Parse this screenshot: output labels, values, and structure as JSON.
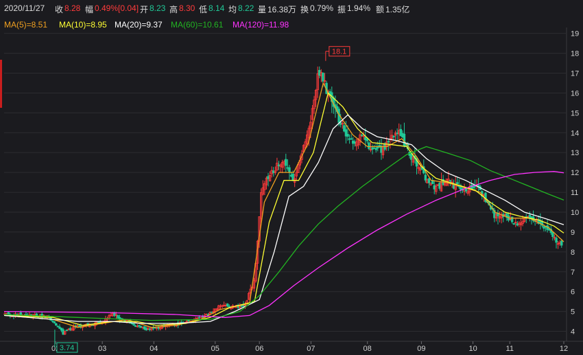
{
  "quote_bar": {
    "date": "2020/11/27",
    "close_label": "收",
    "close_value": "8.28",
    "change_label": "幅",
    "change_value": "0.49%[0.04]",
    "open_label": "开",
    "open_value": "8.23",
    "high_label": "高",
    "high_value": "8.30",
    "low_label": "低",
    "low_value": "8.14",
    "avg_label": "均",
    "avg_value": "8.22",
    "volume_label": "量",
    "volume_value": "16.38万",
    "turnover_label": "换",
    "turnover_value": "0.79%",
    "amplitude_label": "振",
    "amplitude_value": "1.94%",
    "amount_label": "额",
    "amount_value": "1.35亿"
  },
  "ma_legend": [
    {
      "text": "MA(5)=8.51",
      "color": "#f0a020"
    },
    {
      "text": "MA(10)=8.95",
      "color": "#ffff33"
    },
    {
      "text": "MA(20)=9.37",
      "color": "#ffffff"
    },
    {
      "text": "MA(60)=10.61",
      "color": "#22b422"
    },
    {
      "text": "MA(120)=11.98",
      "color": "#ff33ff"
    }
  ],
  "colors": {
    "up": "#ff3b3b",
    "down": "#20c997",
    "grid": "#2c2c30",
    "background": "#1b1b1f"
  },
  "chart_data": {
    "type": "candlestick",
    "ylim": [
      3.5,
      19.3
    ],
    "yticks": [
      4,
      5,
      6,
      7,
      8,
      9,
      10,
      11,
      12,
      13,
      14,
      15,
      16,
      17,
      18,
      19
    ],
    "xticks": [
      "02",
      "03",
      "04",
      "05",
      "06",
      "07",
      "08",
      "09",
      "10",
      "11",
      "12"
    ],
    "xlim": [
      0,
      228
    ],
    "xtick_positions": [
      21,
      40,
      61,
      86,
      104,
      125,
      148,
      170,
      191,
      206,
      228
    ],
    "annotations": [
      {
        "label": "18.1",
        "x": 131,
        "y": 18.1,
        "type": "high"
      },
      {
        "label": "3.74",
        "x": 24,
        "y": 3.74,
        "type": "low"
      }
    ],
    "price_path": [
      [
        0,
        4.85
      ],
      [
        10,
        4.8
      ],
      [
        18,
        4.75
      ],
      [
        22,
        4.2
      ],
      [
        24,
        3.9
      ],
      [
        28,
        4.2
      ],
      [
        34,
        4.3
      ],
      [
        40,
        4.5
      ],
      [
        44,
        4.9
      ],
      [
        48,
        4.6
      ],
      [
        54,
        4.3
      ],
      [
        58,
        4.1
      ],
      [
        64,
        4.2
      ],
      [
        72,
        4.4
      ],
      [
        78,
        4.6
      ],
      [
        84,
        4.9
      ],
      [
        88,
        5.3
      ],
      [
        92,
        5.2
      ],
      [
        98,
        5.3
      ],
      [
        102,
        6.6
      ],
      [
        105,
        11.3
      ],
      [
        110,
        12.2
      ],
      [
        114,
        12.5
      ],
      [
        118,
        11.5
      ],
      [
        121,
        12.8
      ],
      [
        125,
        14.5
      ],
      [
        128,
        17.2
      ],
      [
        131,
        16.3
      ],
      [
        134,
        15.3
      ],
      [
        137,
        14.5
      ],
      [
        140,
        13.8
      ],
      [
        143,
        13.6
      ],
      [
        146,
        13.8
      ],
      [
        150,
        13.0
      ],
      [
        154,
        13.2
      ],
      [
        158,
        13.7
      ],
      [
        161,
        14.0
      ],
      [
        164,
        13.1
      ],
      [
        168,
        12.5
      ],
      [
        172,
        11.6
      ],
      [
        176,
        11.2
      ],
      [
        180,
        11.6
      ],
      [
        184,
        11.3
      ],
      [
        188,
        11.1
      ],
      [
        192,
        11.4
      ],
      [
        196,
        10.7
      ],
      [
        200,
        9.8
      ],
      [
        204,
        9.9
      ],
      [
        208,
        9.4
      ],
      [
        212,
        9.7
      ],
      [
        216,
        9.7
      ],
      [
        220,
        9.3
      ],
      [
        224,
        8.7
      ],
      [
        228,
        8.28
      ]
    ],
    "ma_series": [
      {
        "name": "MA(5)",
        "color": "#f0a020",
        "points": [
          [
            0,
            4.8
          ],
          [
            20,
            4.6
          ],
          [
            30,
            4.2
          ],
          [
            40,
            4.4
          ],
          [
            50,
            4.6
          ],
          [
            60,
            4.2
          ],
          [
            70,
            4.3
          ],
          [
            80,
            4.6
          ],
          [
            88,
            5.1
          ],
          [
            100,
            5.4
          ],
          [
            106,
            10.5
          ],
          [
            112,
            12.0
          ],
          [
            118,
            12.0
          ],
          [
            124,
            13.5
          ],
          [
            130,
            16.5
          ],
          [
            136,
            15.0
          ],
          [
            142,
            13.9
          ],
          [
            148,
            13.3
          ],
          [
            156,
            13.3
          ],
          [
            162,
            13.7
          ],
          [
            168,
            12.8
          ],
          [
            174,
            11.6
          ],
          [
            180,
            11.5
          ],
          [
            186,
            11.3
          ],
          [
            194,
            11.0
          ],
          [
            200,
            10.0
          ],
          [
            206,
            9.7
          ],
          [
            214,
            9.7
          ],
          [
            222,
            9.2
          ],
          [
            228,
            8.51
          ]
        ]
      },
      {
        "name": "MA(10)",
        "color": "#ffff33",
        "points": [
          [
            0,
            4.8
          ],
          [
            20,
            4.7
          ],
          [
            32,
            4.3
          ],
          [
            44,
            4.5
          ],
          [
            54,
            4.5
          ],
          [
            62,
            4.3
          ],
          [
            74,
            4.4
          ],
          [
            84,
            4.7
          ],
          [
            92,
            5.2
          ],
          [
            102,
            5.5
          ],
          [
            108,
            9.5
          ],
          [
            114,
            11.6
          ],
          [
            120,
            11.6
          ],
          [
            126,
            13.0
          ],
          [
            132,
            16.0
          ],
          [
            138,
            15.3
          ],
          [
            144,
            14.2
          ],
          [
            150,
            13.5
          ],
          [
            158,
            13.4
          ],
          [
            164,
            13.3
          ],
          [
            170,
            12.3
          ],
          [
            176,
            11.7
          ],
          [
            184,
            11.4
          ],
          [
            192,
            11.1
          ],
          [
            198,
            10.5
          ],
          [
            204,
            10.0
          ],
          [
            210,
            9.8
          ],
          [
            218,
            9.6
          ],
          [
            224,
            9.3
          ],
          [
            228,
            8.95
          ]
        ]
      },
      {
        "name": "MA(20)",
        "color": "#ffffff",
        "points": [
          [
            0,
            4.8
          ],
          [
            30,
            4.5
          ],
          [
            44,
            4.5
          ],
          [
            56,
            4.4
          ],
          [
            70,
            4.4
          ],
          [
            84,
            4.5
          ],
          [
            94,
            5.0
          ],
          [
            104,
            5.6
          ],
          [
            110,
            8.0
          ],
          [
            116,
            10.8
          ],
          [
            122,
            11.3
          ],
          [
            128,
            12.5
          ],
          [
            134,
            14.2
          ],
          [
            140,
            14.9
          ],
          [
            146,
            14.2
          ],
          [
            152,
            13.8
          ],
          [
            160,
            13.6
          ],
          [
            166,
            13.4
          ],
          [
            172,
            12.7
          ],
          [
            180,
            12.0
          ],
          [
            188,
            11.6
          ],
          [
            196,
            11.1
          ],
          [
            204,
            10.6
          ],
          [
            212,
            10.0
          ],
          [
            220,
            9.7
          ],
          [
            228,
            9.37
          ]
        ]
      },
      {
        "name": "MA(60)",
        "color": "#22b422",
        "points": [
          [
            0,
            4.85
          ],
          [
            30,
            4.7
          ],
          [
            60,
            4.55
          ],
          [
            84,
            4.6
          ],
          [
            96,
            5.0
          ],
          [
            104,
            5.8
          ],
          [
            112,
            7.0
          ],
          [
            120,
            8.3
          ],
          [
            128,
            9.4
          ],
          [
            136,
            10.3
          ],
          [
            146,
            11.3
          ],
          [
            156,
            12.2
          ],
          [
            164,
            12.9
          ],
          [
            172,
            13.3
          ],
          [
            180,
            13.0
          ],
          [
            190,
            12.6
          ],
          [
            198,
            12.1
          ],
          [
            206,
            11.7
          ],
          [
            214,
            11.3
          ],
          [
            222,
            10.9
          ],
          [
            228,
            10.61
          ]
        ]
      },
      {
        "name": "MA(120)",
        "color": "#ff33ff",
        "points": [
          [
            0,
            5.0
          ],
          [
            40,
            4.95
          ],
          [
            70,
            4.85
          ],
          [
            90,
            4.7
          ],
          [
            100,
            4.8
          ],
          [
            108,
            5.3
          ],
          [
            118,
            6.3
          ],
          [
            128,
            7.2
          ],
          [
            140,
            8.2
          ],
          [
            152,
            9.1
          ],
          [
            164,
            9.9
          ],
          [
            176,
            10.6
          ],
          [
            188,
            11.2
          ],
          [
            198,
            11.6
          ],
          [
            208,
            11.9
          ],
          [
            216,
            12.0
          ],
          [
            224,
            12.05
          ],
          [
            228,
            11.98
          ]
        ]
      }
    ]
  }
}
